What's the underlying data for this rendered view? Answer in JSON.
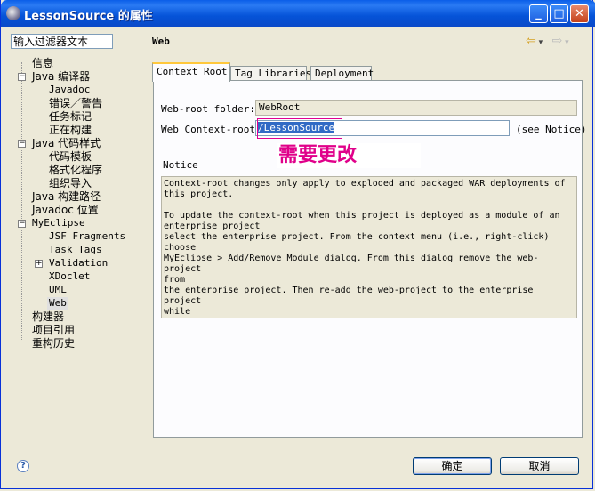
{
  "window": {
    "title": "LessonSource 的属性"
  },
  "filter": {
    "value": "输入过滤器文本"
  },
  "tree": {
    "items": [
      {
        "label": "信息"
      },
      {
        "label": "Java 编译器"
      },
      {
        "label": "Javadoc"
      },
      {
        "label": "错误／警告"
      },
      {
        "label": "任务标记"
      },
      {
        "label": "正在构建"
      },
      {
        "label": "Java 代码样式"
      },
      {
        "label": "代码模板"
      },
      {
        "label": "格式化程序"
      },
      {
        "label": "组织导入"
      },
      {
        "label": "Java 构建路径"
      },
      {
        "label": "Javadoc 位置"
      },
      {
        "label": "MyEclipse"
      },
      {
        "label": "JSF Fragments"
      },
      {
        "label": "Task Tags"
      },
      {
        "label": "Validation"
      },
      {
        "label": "XDoclet"
      },
      {
        "label": "UML"
      },
      {
        "label": "Web"
      },
      {
        "label": "构建器"
      },
      {
        "label": "项目引用"
      },
      {
        "label": "重构历史"
      }
    ],
    "selected": "Web"
  },
  "page": {
    "title": "Web"
  },
  "tabs": [
    {
      "label": "Context Root"
    },
    {
      "label": "Tag Libraries"
    },
    {
      "label": "Deployment"
    }
  ],
  "form": {
    "web_root_label": "Web-root folder:",
    "web_root_value": "WebRoot",
    "context_root_label": "Web Context-root:",
    "context_root_value": "/LessonSource",
    "see_notice": "(see Notice)",
    "notice_label": "Notice"
  },
  "annotation": {
    "text": "需要更改"
  },
  "notice": {
    "text": "Context-root changes only apply to exploded and packaged WAR deployments of\nthis project.\n\nTo update the context-root when this project is deployed as a module of an\nenterprise project\nselect the enterprise project. From the context menu (i.e., right-click)\nchoose\nMyEclipse > Add/Remove Module dialog. From this dialog remove the web-project\nfrom\nthe enterprise project. Then re-add the web-project to the enterprise project\nwhile\nspecifying the new context-root."
  },
  "buttons": {
    "ok": "确定",
    "cancel": "取消",
    "help": "?"
  },
  "colors": {
    "annotation": "#e0008a",
    "titlebar": "#0a5ee8"
  }
}
